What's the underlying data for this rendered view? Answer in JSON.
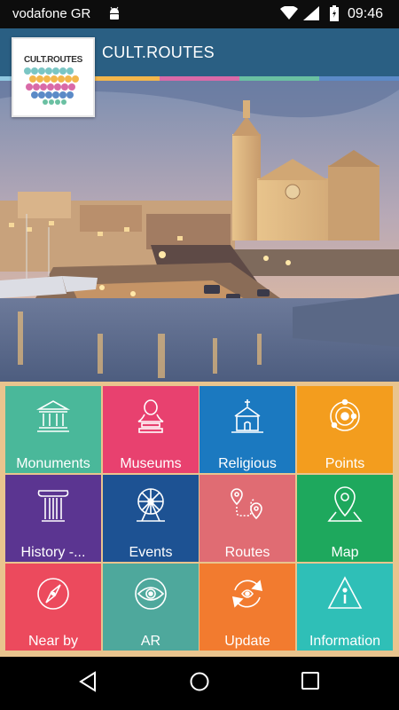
{
  "status_bar": {
    "carrier": "vodafone GR",
    "time": "09:46"
  },
  "app_bar": {
    "title": "CULT.ROUTES"
  },
  "logo": {
    "text": "CULT.ROUTES"
  },
  "accent_colors": [
    "#8fc7e0",
    "#f2b64b",
    "#d96aa8",
    "#6ac0a2",
    "#5b8ac7"
  ],
  "tiles": [
    {
      "label": "Monuments",
      "color": "#4ab89a",
      "icon": "monument-icon"
    },
    {
      "label": "Museums",
      "color": "#e8416f",
      "icon": "bust-icon"
    },
    {
      "label": "Religious",
      "color": "#1b79c0",
      "icon": "church-icon"
    },
    {
      "label": "Points",
      "color": "#f39d1e",
      "icon": "orbit-icon"
    },
    {
      "label": "History -...",
      "color": "#5b3591",
      "icon": "column-icon"
    },
    {
      "label": "Events",
      "color": "#1d5293",
      "icon": "ferris-wheel-icon"
    },
    {
      "label": "Routes",
      "color": "#e06c73",
      "icon": "route-icon"
    },
    {
      "label": "Map",
      "color": "#1ea85d",
      "icon": "map-pin-icon"
    },
    {
      "label": "Near by",
      "color": "#ec4a5d",
      "icon": "compass-icon"
    },
    {
      "label": "AR",
      "color": "#4ea89c",
      "icon": "eye-icon"
    },
    {
      "label": "Update",
      "color": "#f27b2f",
      "icon": "refresh-icon"
    },
    {
      "label": "Information",
      "color": "#2fbfb7",
      "icon": "info-icon"
    }
  ]
}
